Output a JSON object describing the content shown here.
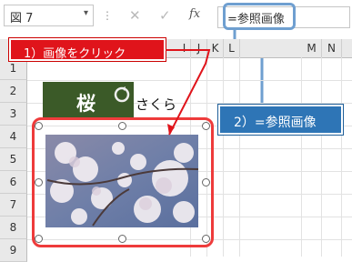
{
  "formula_bar": {
    "name_box_value": "図 7",
    "name_box_dropdown": "▾",
    "grip": "⋮",
    "cancel_glyph": "✕",
    "confirm_glyph": "✓",
    "fx_label": "fx",
    "formula_value": "=参照画像"
  },
  "columns": [
    "I",
    "J",
    "K",
    "L",
    "M",
    "N"
  ],
  "rows": [
    "1",
    "2",
    "3",
    "4",
    "5",
    "6",
    "7",
    "8",
    "9"
  ],
  "callout1": {
    "text": "1）画像をクリック",
    "color": "#e0141b"
  },
  "callout2": {
    "text": "2）=参照画像",
    "color": "#2e75b6"
  },
  "cell_label": {
    "kanji": "桜",
    "hiragana": "さくら",
    "fill": "#3b5a28"
  },
  "image": {
    "description_icon": "cherry-blossom-photo"
  },
  "colors": {
    "selection": "#ee3b3b",
    "formula_highlight": "#6f9fd0",
    "header_bg": "#e9e9e9"
  }
}
